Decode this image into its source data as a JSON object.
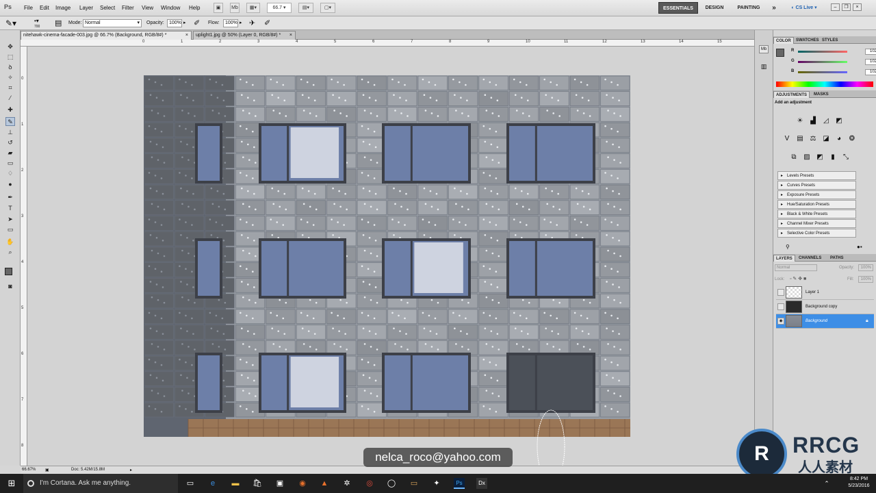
{
  "app": {
    "logo": "Ps",
    "menus": [
      "File",
      "Edit",
      "Image",
      "Layer",
      "Select",
      "Filter",
      "View",
      "Window",
      "Help"
    ],
    "zoom_field": "66.7",
    "workspaces": [
      "ESSENTIALS",
      "DESIGN",
      "PAINTING"
    ],
    "workspace_more": "»",
    "cs_live": "CS Live"
  },
  "options_bar": {
    "brush_size": "700",
    "mode_label": "Mode:",
    "mode_value": "Normal",
    "opacity_label": "Opacity:",
    "opacity_value": "100%",
    "flow_label": "Flow:",
    "flow_value": "100%"
  },
  "documents": {
    "tabs": [
      {
        "label": "nitehawk-cinema-facade-003.jpg @ 66.7% (Background, RGB/8#) *",
        "close": "×"
      },
      {
        "label": "uplight1.jpg @ 50% (Layer 0, RGB/8#) *",
        "close": "×"
      }
    ]
  },
  "rulers": {
    "top": [
      "0",
      "1",
      "2",
      "3",
      "4",
      "5",
      "6",
      "7",
      "8",
      "9",
      "10",
      "11",
      "12",
      "13",
      "14",
      "15",
      "16"
    ],
    "left": [
      "0",
      "1",
      "2",
      "3",
      "4",
      "5",
      "6",
      "7",
      "8"
    ]
  },
  "status": {
    "zoom": "66.67%",
    "doc": "Doc: 5.42M/15.8M"
  },
  "color_panel": {
    "tabs": [
      "COLOR",
      "SWATCHES",
      "STYLES"
    ],
    "channels": [
      {
        "label": "R",
        "value": "102"
      },
      {
        "label": "G",
        "value": "102"
      },
      {
        "label": "B",
        "value": "102"
      }
    ]
  },
  "adjustments_panel": {
    "tabs": [
      "ADJUSTMENTS",
      "MASKS"
    ],
    "heading": "Add an adjustment",
    "presets": [
      "Levels Presets",
      "Curves Presets",
      "Exposure Presets",
      "Hue/Saturation Presets",
      "Black & White Presets",
      "Channel Mixer Presets",
      "Selective Color Presets"
    ]
  },
  "layers_panel": {
    "tabs": [
      "LAYERS",
      "CHANNELS",
      "PATHS"
    ],
    "blend_mode": "Normal",
    "opacity_label": "Opacity:",
    "opacity_value": "100%",
    "lock_label": "Lock:",
    "fill_label": "Fill:",
    "fill_value": "100%",
    "layers": [
      {
        "name": "Layer 1",
        "visible": false,
        "selected": false
      },
      {
        "name": "Background copy",
        "visible": false,
        "selected": false
      },
      {
        "name": "Background",
        "visible": true,
        "selected": true
      }
    ]
  },
  "overlay": {
    "email": "nelca_roco@yahoo.com",
    "brand": "RRCG",
    "brand_sub": "人人素材",
    "brand_mark": "R"
  },
  "taskbar": {
    "cortana": "I'm Cortana. Ask me anything.",
    "time": "8:42 PM",
    "date": "5/23/2016"
  },
  "colors": {
    "selection_blue": "#3d8ee6",
    "panel_gray": "#d6d6d6",
    "foreground_swatch": "#666666"
  }
}
